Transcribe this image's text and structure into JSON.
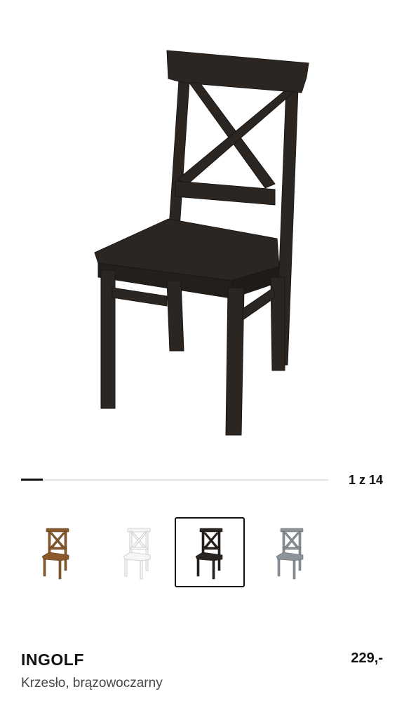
{
  "gallery": {
    "current_index": 1,
    "total": 14,
    "counter_text": "1 z 14"
  },
  "variants": [
    {
      "icon": "chair-brown-icon",
      "color": "#8a5a2b",
      "selected": false
    },
    {
      "icon": "chair-white-icon",
      "color": "#f4f4f4",
      "selected": false
    },
    {
      "icon": "chair-black-brown-icon",
      "color": "#2a2420",
      "selected": true
    },
    {
      "icon": "chair-gray-icon",
      "color": "#8c949a",
      "selected": false
    }
  ],
  "product": {
    "name": "INGOLF",
    "description": "Krzesło, brązowoczarny",
    "price": "229,-"
  }
}
